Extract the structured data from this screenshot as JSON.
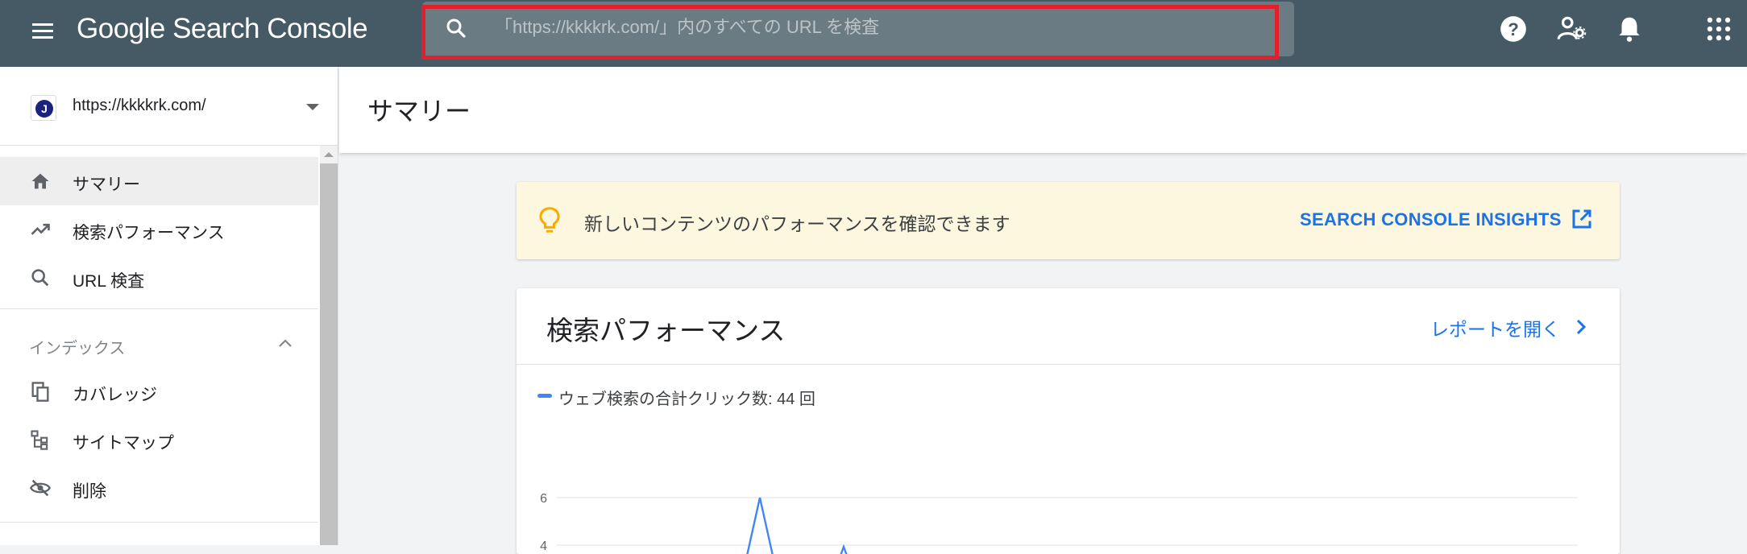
{
  "topbar": {
    "menu_icon": "menu-icon",
    "logo_text": "Google Search Console",
    "search": {
      "placeholder": "「https://kkkkrk.com/」内のすべての URL を検査",
      "value": ""
    },
    "icons": [
      "help-icon",
      "manage-users-icon",
      "notifications-icon",
      "apps-grid-icon"
    ]
  },
  "sidebar": {
    "property": {
      "avatar_letter": "J",
      "url": "https://kkkkrk.com/"
    },
    "items": [
      {
        "label": "サマリー",
        "icon": "home-icon",
        "active": true
      },
      {
        "label": "検索パフォーマンス",
        "icon": "trending-up-icon"
      },
      {
        "label": "URL 検査",
        "icon": "search-icon"
      }
    ],
    "index_section": {
      "label": "インデックス",
      "items": [
        {
          "label": "カバレッジ",
          "icon": "coverage-icon"
        },
        {
          "label": "サイトマップ",
          "icon": "sitemap-icon"
        },
        {
          "label": "削除",
          "icon": "removals-icon"
        }
      ]
    }
  },
  "main": {
    "page_title": "サマリー",
    "insights": {
      "text": "新しいコンテンツのパフォーマンスを確認できます",
      "link_label": "SEARCH CONSOLE INSIGHTS"
    },
    "performance": {
      "title": "検索パフォーマンス",
      "report_link": "レポートを開く",
      "legend": "ウェブ検索の合計クリック数: 44 回"
    }
  },
  "chart_data": {
    "type": "line",
    "series": [
      {
        "name": "ウェブ検索の合計クリック数: 44 回",
        "color": "#4285f4",
        "values": [
          6,
          4
        ]
      }
    ],
    "y_ticks": [
      "6",
      "4"
    ],
    "visible_y_range": [
      3.8,
      6
    ]
  },
  "colors": {
    "topbar": "#455a64",
    "accent": "#1a73e8",
    "highlight_border": "#e2202c",
    "insights_bg": "#fdf7e0",
    "series": "#4285f4"
  }
}
